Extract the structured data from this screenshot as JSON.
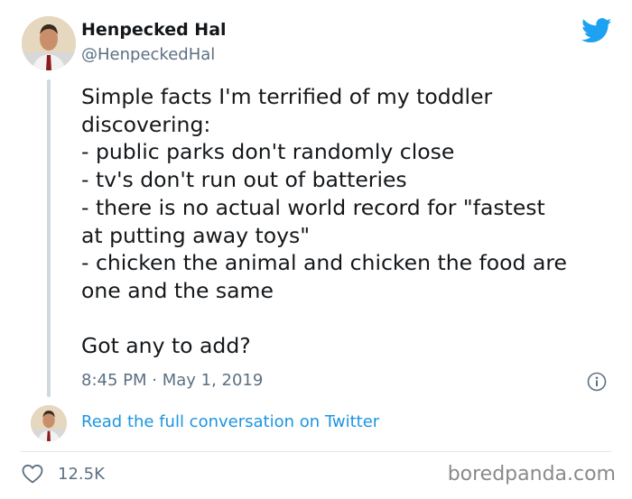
{
  "author": {
    "display_name": "Henpecked Hal",
    "handle": "@HenpeckedHal",
    "avatar_icon": "avatar-portrait"
  },
  "brand": {
    "icon": "twitter-bird-icon",
    "color": "#1da1f2"
  },
  "tweet": {
    "lines": [
      "Simple facts I'm terrified of my toddler",
      "discovering:",
      "- public parks don't randomly close",
      "- tv's don't run out of batteries",
      "- there is no actual world record for \"fastest",
      "at putting away toys\"",
      "- chicken the animal and chicken the food are",
      "one and the same",
      "",
      "Got any to add?"
    ],
    "timestamp": "8:45 PM · May 1, 2019"
  },
  "conversation_link": {
    "label": "Read the full conversation on Twitter",
    "color": "#1b95e0"
  },
  "engagement": {
    "likes": "12.5K"
  },
  "watermark": "boredpanda.com",
  "colors": {
    "text_primary": "#14171a",
    "text_secondary": "#5b7083",
    "thread_line": "#cfd9de",
    "divider": "#e1e8ed"
  }
}
